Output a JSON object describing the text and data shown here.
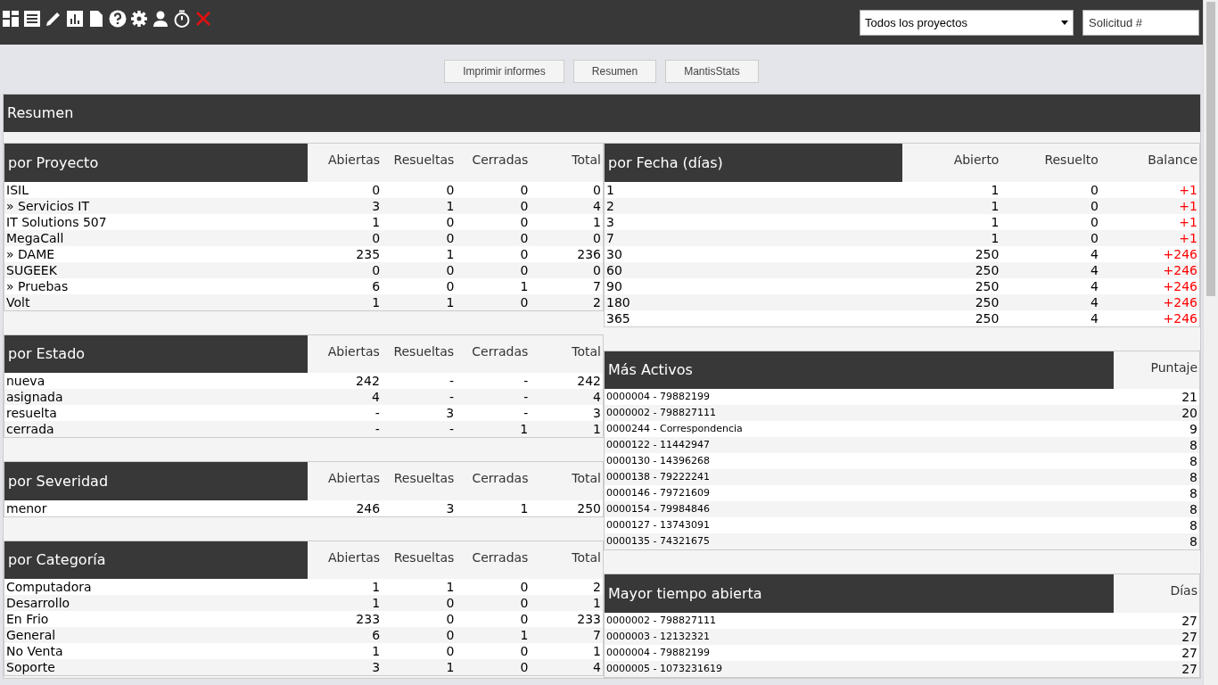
{
  "top_bar": {
    "project_select": {
      "value": "Todos los proyectos"
    },
    "search": {
      "placeholder": "Solicitud #"
    }
  },
  "menu_buttons": [
    "Imprimir informes",
    "Resumen",
    "MantisStats"
  ],
  "page_title": "Resumen",
  "left_tables": [
    {
      "kind": "counts",
      "columns": [
        "por Proyecto",
        "Abiertas",
        "Resueltas",
        "Cerradas",
        "Total"
      ],
      "rows": [
        [
          "ISIL",
          "0",
          "0",
          "0",
          "0"
        ],
        [
          "» Servicios IT",
          "3",
          "1",
          "0",
          "4"
        ],
        [
          "IT Solutions 507",
          "1",
          "0",
          "0",
          "1"
        ],
        [
          "MegaCall",
          "0",
          "0",
          "0",
          "0"
        ],
        [
          "» DAME",
          "235",
          "1",
          "0",
          "236"
        ],
        [
          "SUGEEK",
          "0",
          "0",
          "0",
          "0"
        ],
        [
          "» Pruebas",
          "6",
          "0",
          "1",
          "7"
        ],
        [
          "Volt",
          "1",
          "1",
          "0",
          "2"
        ]
      ]
    },
    {
      "kind": "counts",
      "columns": [
        "por Estado",
        "Abiertas",
        "Resueltas",
        "Cerradas",
        "Total"
      ],
      "rows": [
        [
          "nueva",
          "242",
          "-",
          "-",
          "242"
        ],
        [
          "asignada",
          "4",
          "-",
          "-",
          "4"
        ],
        [
          "resuelta",
          "-",
          "3",
          "-",
          "3"
        ],
        [
          "cerrada",
          "-",
          "-",
          "1",
          "1"
        ]
      ]
    },
    {
      "kind": "counts",
      "columns": [
        "por Severidad",
        "Abiertas",
        "Resueltas",
        "Cerradas",
        "Total"
      ],
      "rows": [
        [
          "menor",
          "246",
          "3",
          "1",
          "250"
        ]
      ]
    },
    {
      "kind": "counts",
      "columns": [
        "por Categoría",
        "Abiertas",
        "Resueltas",
        "Cerradas",
        "Total"
      ],
      "rows": [
        [
          "Computadora",
          "1",
          "1",
          "0",
          "2"
        ],
        [
          "Desarrollo",
          "1",
          "0",
          "0",
          "1"
        ],
        [
          "En Frio",
          "233",
          "0",
          "0",
          "233"
        ],
        [
          "General",
          "6",
          "0",
          "1",
          "7"
        ],
        [
          "No Venta",
          "1",
          "0",
          "0",
          "1"
        ],
        [
          "Soporte",
          "3",
          "1",
          "0",
          "4"
        ]
      ]
    }
  ],
  "right_tables": [
    {
      "kind": "balance",
      "columns": [
        "por Fecha (días)",
        "Abierto",
        "Resuelto",
        "Balance"
      ],
      "rows": [
        [
          "1",
          "1",
          "0",
          "+1"
        ],
        [
          "2",
          "1",
          "0",
          "+1"
        ],
        [
          "3",
          "1",
          "0",
          "+1"
        ],
        [
          "7",
          "1",
          "0",
          "+1"
        ],
        [
          "30",
          "250",
          "4",
          "+246"
        ],
        [
          "60",
          "250",
          "4",
          "+246"
        ],
        [
          "90",
          "250",
          "4",
          "+246"
        ],
        [
          "180",
          "250",
          "4",
          "+246"
        ],
        [
          "365",
          "250",
          "4",
          "+246"
        ]
      ]
    },
    {
      "kind": "ranking",
      "columns": [
        "Más Activos",
        "Puntaje"
      ],
      "rows": [
        [
          "0000004 - 79882199",
          "21"
        ],
        [
          "0000002 - 798827111",
          "20"
        ],
        [
          "0000244 - Correspondencia",
          "9"
        ],
        [
          "0000122 - 11442947",
          "8"
        ],
        [
          "0000130 - 14396268",
          "8"
        ],
        [
          "0000138 - 79222241",
          "8"
        ],
        [
          "0000146 - 79721609",
          "8"
        ],
        [
          "0000154 - 79984846",
          "8"
        ],
        [
          "0000127 - 13743091",
          "8"
        ],
        [
          "0000135 - 74321675",
          "8"
        ]
      ]
    },
    {
      "kind": "ranking",
      "columns": [
        "Mayor tiempo abierta",
        "Días"
      ],
      "rows": [
        [
          "0000002 - 798827111",
          "27"
        ],
        [
          "0000003 - 12132321",
          "27"
        ],
        [
          "0000004 - 79882199",
          "27"
        ],
        [
          "0000005 - 1073231619",
          "27"
        ]
      ]
    }
  ]
}
